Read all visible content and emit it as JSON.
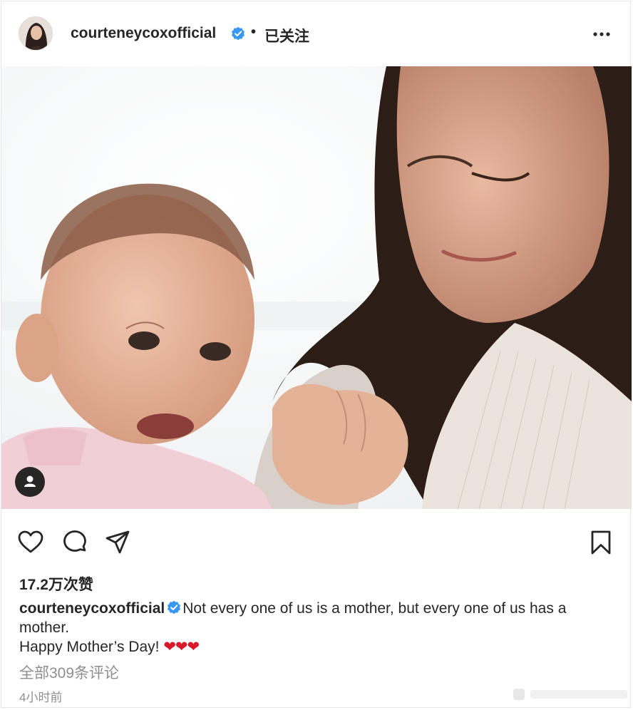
{
  "header": {
    "username": "courteneycoxofficial",
    "separator": "•",
    "follow_status": "已关注"
  },
  "actions": {
    "like_icon": "heart-icon",
    "comment_icon": "comment-icon",
    "share_icon": "paper-plane-icon",
    "save_icon": "bookmark-icon"
  },
  "likes": "17.2万次赞",
  "caption": {
    "username": "courteneycoxofficial",
    "text_line1": "Not every one of us is a mother, but every one of us has a mother.",
    "text_line2": "Happy Mother’s Day! ",
    "hearts": "❤❤❤"
  },
  "comments_link": "全部309条评论",
  "timestamp": "4小时前",
  "colors": {
    "verified": "#3897f0",
    "text": "#262626",
    "muted": "#8e8e8e",
    "heart": "#d9182b"
  }
}
